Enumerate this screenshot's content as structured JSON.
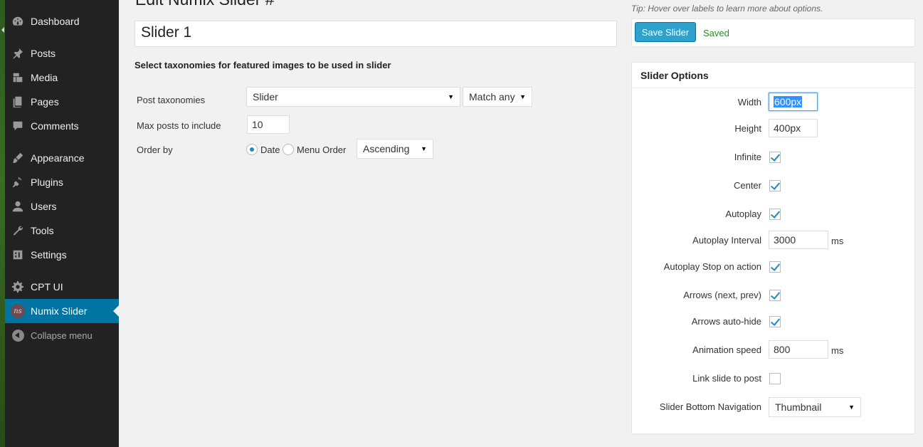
{
  "sidebar": {
    "items": [
      {
        "label": "Dashboard",
        "icon": "dashboard-icon"
      },
      {
        "label": "Posts",
        "icon": "pin-icon"
      },
      {
        "label": "Media",
        "icon": "media-icon"
      },
      {
        "label": "Pages",
        "icon": "pages-icon"
      },
      {
        "label": "Comments",
        "icon": "comment-icon"
      },
      {
        "label": "Appearance",
        "icon": "brush-icon"
      },
      {
        "label": "Plugins",
        "icon": "plug-icon"
      },
      {
        "label": "Users",
        "icon": "user-icon"
      },
      {
        "label": "Tools",
        "icon": "wrench-icon"
      },
      {
        "label": "Settings",
        "icon": "settings-icon"
      },
      {
        "label": "CPT UI",
        "icon": "gear-icon"
      },
      {
        "label": "Numix Slider",
        "icon": "numix-logo-icon"
      }
    ],
    "logo_text": "ns",
    "collapse_label": "Collapse menu",
    "active_color": "#0074a2"
  },
  "main": {
    "page_title": "Edit Numix Slider #",
    "slider_title": "Slider 1",
    "section_heading": "Select taxonomies for featured images to be used in slider",
    "post_taxonomies_label": "Post taxonomies",
    "taxonomy_value": "Slider",
    "match_value": "Match any",
    "max_posts_label": "Max posts to include",
    "max_posts_value": "10",
    "order_by_label": "Order by",
    "order_date_label": "Date",
    "order_menu_label": "Menu Order",
    "order_direction": "Ascending"
  },
  "panel": {
    "tip": "Tip: Hover over labels to learn more about options.",
    "save_label": "Save Slider",
    "saved_label": "Saved",
    "options_title": "Slider Options",
    "width_label": "Width",
    "width_value": "600px",
    "height_label": "Height",
    "height_value": "400px",
    "infinite_label": "Infinite",
    "center_label": "Center",
    "autoplay_label": "Autoplay",
    "autoplay_interval_label": "Autoplay Interval",
    "autoplay_interval_value": "3000",
    "ms_unit": "ms",
    "autoplay_stop_label": "Autoplay Stop on action",
    "arrows_label": "Arrows (next, prev)",
    "arrows_autohide_label": "Arrows auto-hide",
    "animation_speed_label": "Animation speed",
    "animation_speed_value": "800",
    "link_slide_label": "Link slide to post",
    "bottom_nav_label": "Slider Bottom Navigation",
    "bottom_nav_value": "Thumbnail"
  }
}
